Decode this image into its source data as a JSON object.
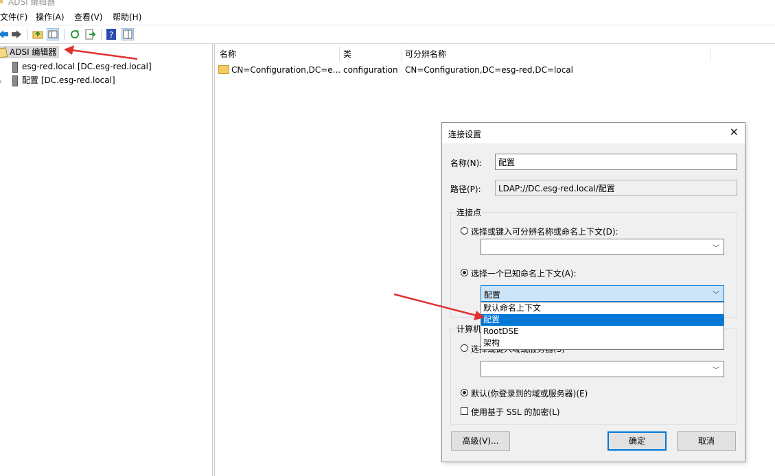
{
  "window": {
    "title": "ADSI 编辑器"
  },
  "menu": [
    "文件(F)",
    "操作(A)",
    "查看(V)",
    "帮助(H)"
  ],
  "toolbar": [
    "back-icon",
    "forward-icon",
    "up-folder-icon",
    "show-hide-tree-icon",
    "refresh-icon",
    "export-list-icon",
    "help-icon",
    "properties-icon"
  ],
  "tree": {
    "root": "ADSI 编辑器",
    "items": [
      "esg-red.local [DC.esg-red.local]",
      "配置 [DC.esg-red.local]"
    ]
  },
  "list": {
    "columns": [
      "名称",
      "类",
      "可分辨名称"
    ],
    "rows": [
      {
        "name": "CN=Configuration,DC=e...",
        "class": "configuration",
        "dn": "CN=Configuration,DC=esg-red,DC=local"
      }
    ]
  },
  "dialog": {
    "title": "连接设置",
    "name_label": "名称(N):",
    "name_value": "配置",
    "path_label": "路径(P):",
    "path_value": "LDAP://DC.esg-red.local/配置",
    "connection_point": {
      "label": "连接点",
      "option_dn": "选择或键入可分辨名称或命名上下文(D):",
      "dn_value": "",
      "option_known": "选择一个已知命名上下文(A):",
      "known_value": "配置",
      "dropdown_options": [
        "默认命名上下文",
        "配置",
        "RootDSE",
        "架构"
      ],
      "selected_option": "配置"
    },
    "computer": {
      "label": "计算机",
      "option_select": "选择或键入域或服务器(S)",
      "server_value": "",
      "option_default": "默认(你登录到的域或服务器)(E)",
      "ssl_label": "使用基于 SSL 的加密(L)"
    },
    "buttons": {
      "advanced": "高级(V)...",
      "ok": "确定",
      "cancel": "取消"
    }
  },
  "colors": {
    "accent": "#0078d7",
    "annotation_arrow": "#e03030"
  }
}
